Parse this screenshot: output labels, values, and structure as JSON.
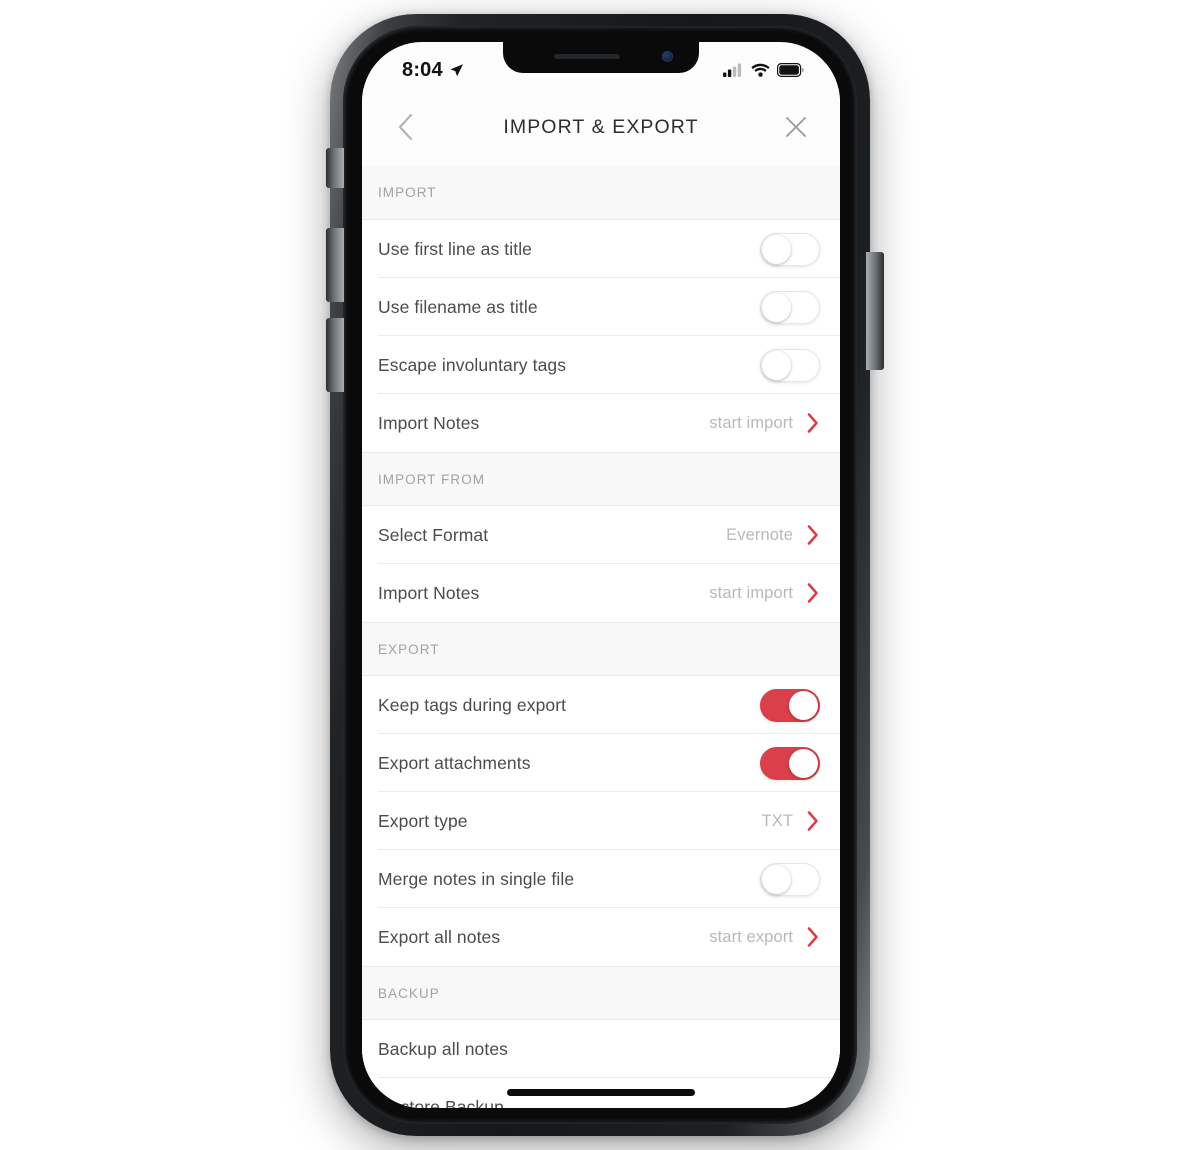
{
  "status_bar": {
    "time": "8:04",
    "location_icon": "location-arrow-icon",
    "signal_icon": "cellular-signal-icon",
    "signal_bars_filled": 2,
    "signal_bars_total": 4,
    "wifi_icon": "wifi-icon",
    "battery_icon": "battery-full-icon"
  },
  "navbar": {
    "back_icon": "chevron-left-icon",
    "title": "IMPORT & EXPORT",
    "close_icon": "close-x-icon"
  },
  "colors": {
    "accent_red": "#d9404a",
    "chevron_red": "#d9404a",
    "label": "#4c4c4f",
    "value": "#b9b9bd",
    "section_header": "#a2a2a6",
    "section_bg": "#f8f8f9",
    "separator": "#ececee"
  },
  "sections": [
    {
      "header": "IMPORT",
      "rows": [
        {
          "label": "Use first line as title",
          "type": "toggle",
          "state": "off",
          "name": "row-use-first-line-as-title"
        },
        {
          "label": "Use filename as title",
          "type": "toggle",
          "state": "off",
          "name": "row-use-filename-as-title"
        },
        {
          "label": "Escape involuntary tags",
          "type": "toggle",
          "state": "off",
          "name": "row-escape-involuntary-tags"
        },
        {
          "label": "Import Notes",
          "type": "action",
          "value": "start import",
          "name": "row-import-notes"
        }
      ]
    },
    {
      "header": "IMPORT FROM",
      "rows": [
        {
          "label": "Select Format",
          "type": "disclosure",
          "value": "Evernote",
          "name": "row-select-format"
        },
        {
          "label": "Import Notes",
          "type": "action",
          "value": "start import",
          "name": "row-import-notes-from"
        }
      ]
    },
    {
      "header": "EXPORT",
      "rows": [
        {
          "label": "Keep tags during export",
          "type": "toggle",
          "state": "on",
          "name": "row-keep-tags-during-export"
        },
        {
          "label": "Export attachments",
          "type": "toggle",
          "state": "on",
          "name": "row-export-attachments"
        },
        {
          "label": "Export type",
          "type": "disclosure",
          "value": "TXT",
          "name": "row-export-type"
        },
        {
          "label": "Merge notes in single file",
          "type": "toggle",
          "state": "off",
          "name": "row-merge-notes-in-single-file"
        },
        {
          "label": "Export all notes",
          "type": "action",
          "value": "start export",
          "name": "row-export-all-notes"
        }
      ]
    },
    {
      "header": "BACKUP",
      "rows": [
        {
          "label": "Backup all notes",
          "type": "plain",
          "name": "row-backup-all-notes"
        },
        {
          "label": "Restore Backup",
          "type": "plain",
          "clipped": true,
          "name": "row-restore-backup"
        }
      ]
    }
  ]
}
